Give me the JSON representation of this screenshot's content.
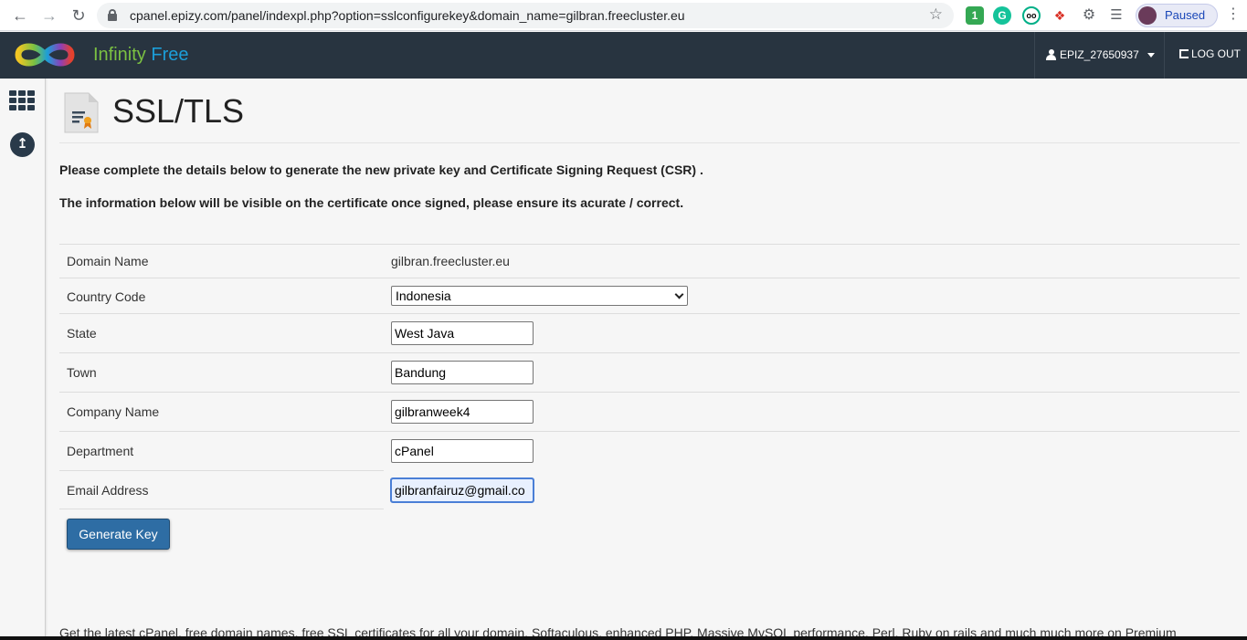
{
  "browser": {
    "url": "cpanel.epizy.com/panel/indexpl.php?option=sslconfigurekey&domain_name=gilbran.freecluster.eu",
    "profile_label": "Paused",
    "extension_badge": "1"
  },
  "header": {
    "brand_infinity": "Infinity",
    "brand_free": "Free",
    "username": "EPIZ_27650937",
    "logout_label": "LOG OUT",
    "colors": {
      "bg": "#283440",
      "brand_green": "#7bc142",
      "brand_blue": "#1c9ed8"
    }
  },
  "page": {
    "title": "SSL/TLS",
    "intro_1": "Please complete the details below to generate the new private key and Certificate Signing Request (CSR) .",
    "intro_2": "The information below will be visible on the certificate once signed, please ensure its acurate / correct."
  },
  "form": {
    "domain": {
      "label": "Domain Name",
      "value": "gilbran.freecluster.eu"
    },
    "country": {
      "label": "Country Code",
      "value": "Indonesia"
    },
    "state": {
      "label": "State",
      "value": "West Java"
    },
    "town": {
      "label": "Town",
      "value": "Bandung"
    },
    "company": {
      "label": "Company Name",
      "value": "gilbranweek4"
    },
    "department": {
      "label": "Department",
      "value": "cPanel"
    },
    "email": {
      "label": "Email Address",
      "value": "gilbranfairuz@gmail.co"
    },
    "submit_label": "Generate Key"
  },
  "footer": {
    "text": "Get the latest cPanel, free domain names, free SSL certificates for all your domain, Softaculous, enhanced PHP, Massive MySQL performance, Perl, Ruby on rails and much much more on Premium"
  }
}
